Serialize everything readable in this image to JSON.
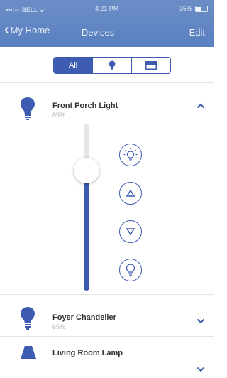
{
  "status_bar": {
    "carrier": "•••○○ BELL ᯤ",
    "time": "4:21 PM",
    "battery": "35%"
  },
  "nav": {
    "back_label": "My Home",
    "title": "Devices",
    "edit_label": "Edit"
  },
  "filter": {
    "all_label": "All",
    "selected": "All"
  },
  "devices": [
    {
      "name": "Front Porch Light",
      "level": "85%",
      "expanded": true
    },
    {
      "name": "Foyer Chandelier",
      "level": "65%",
      "expanded": false
    },
    {
      "name": "Living Room Lamp",
      "level": "",
      "expanded": false
    }
  ],
  "dimmer": {
    "level_fraction": 0.72
  },
  "colors": {
    "accent": "#3d5bb0",
    "header": "#6b8dc6",
    "track": "#e6e6e9"
  }
}
